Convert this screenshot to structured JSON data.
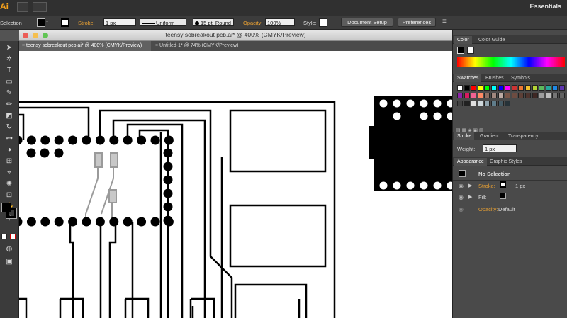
{
  "app": {
    "logo": "Ai",
    "workspace": "Essentials"
  },
  "control_bar": {
    "selection_label": "Selection",
    "stroke_label": "Stroke:",
    "stroke_value": "1 px",
    "stroke_profile": "Uniform",
    "brush_label": "15 pt. Round",
    "opacity_label": "Opacity:",
    "opacity_value": "100%",
    "style_label": "Style:",
    "document_setup": "Document Setup",
    "preferences": "Preferences"
  },
  "document": {
    "window_title": "teensy sobreakout pcb.ai* @ 400% (CMYK/Preview)",
    "tabs": [
      {
        "label": "teensy sobreakout pcb.ai* @ 400% (CMYK/Preview)",
        "active": true
      },
      {
        "label": "Untitled-1* @ 74% (CMYK/Preview)",
        "active": false
      }
    ]
  },
  "panels": {
    "color_tabs": [
      "Color",
      "Color Guide"
    ],
    "swatch_tabs": [
      "Swatches",
      "Brushes",
      "Symbols"
    ],
    "stroke_tabs": [
      "Stroke",
      "Gradient",
      "Transparency"
    ],
    "weight_label": "Weight:",
    "weight_value": "1 px",
    "appearance_tabs": [
      "Appearance",
      "Graphic Styles"
    ],
    "appearance": {
      "target": "No Selection",
      "stroke_label": "Stroke:",
      "stroke_value": "1 px",
      "fill_label": "Fill:",
      "opacity_label": "Opacity:",
      "opacity_value": "Default"
    }
  },
  "colors": {
    "accent": "#f7a21b",
    "panel_bg": "#4a4a4a",
    "canvas_bg": "#ffffff",
    "trace": "#000000",
    "led_pad": "#c8c8c8"
  },
  "icons": [
    "selection-tool-icon",
    "direct-selection-tool-icon",
    "type-tool-icon",
    "rectangle-tool-icon",
    "pen-tool-icon",
    "zoom-tool-icon",
    "eye-icon",
    "disclosure-triangle-icon"
  ]
}
